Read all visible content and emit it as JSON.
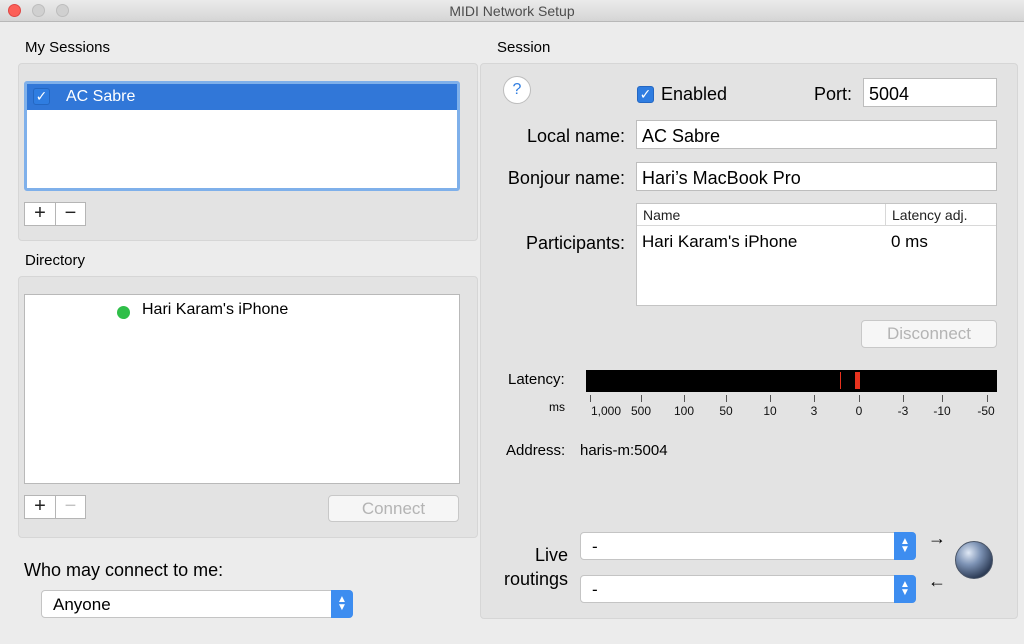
{
  "window": {
    "title": "MIDI Network Setup"
  },
  "sessions": {
    "title": "My Sessions",
    "items": [
      {
        "label": "AC Sabre",
        "checked": true,
        "selected": true
      }
    ],
    "add_label": "+",
    "remove_label": "−"
  },
  "directory": {
    "title": "Directory",
    "items": [
      {
        "label": "Hari Karam's iPhone",
        "status_color": "#2fbf49"
      }
    ],
    "add_label": "+",
    "remove_label": "−",
    "connect_label": "Connect"
  },
  "who_may_connect": {
    "label": "Who may connect to me:",
    "selected": "Anyone"
  },
  "session": {
    "title": "Session",
    "help_label": "?",
    "enabled_label": "Enabled",
    "enabled": true,
    "port_label": "Port:",
    "port_value": "5004",
    "local_name_label": "Local name:",
    "local_name_value": "AC Sabre",
    "bonjour_name_label": "Bonjour name:",
    "bonjour_name_value": "Hari’s MacBook Pro",
    "participants_label": "Participants:",
    "participants_columns": [
      "Name",
      "Latency adj."
    ],
    "participants_rows": [
      {
        "name": "Hari Karam's iPhone",
        "latency": "0 ms"
      }
    ],
    "disconnect_label": "Disconnect",
    "latency_label": "Latency:",
    "latency_unit": "ms",
    "latency_scale": [
      "1,000",
      "500",
      "100",
      "50",
      "10",
      "3",
      "0",
      "-3",
      "-10",
      "-50"
    ],
    "address_label": "Address:",
    "address_value": "haris-m:5004",
    "live_label": "Live",
    "routings_label": "routings",
    "routing_in": "-",
    "routing_out": "-"
  },
  "colors": {
    "accent": "#3177d8",
    "latency_marker": "#e8321e",
    "status_green": "#2fbf49"
  }
}
